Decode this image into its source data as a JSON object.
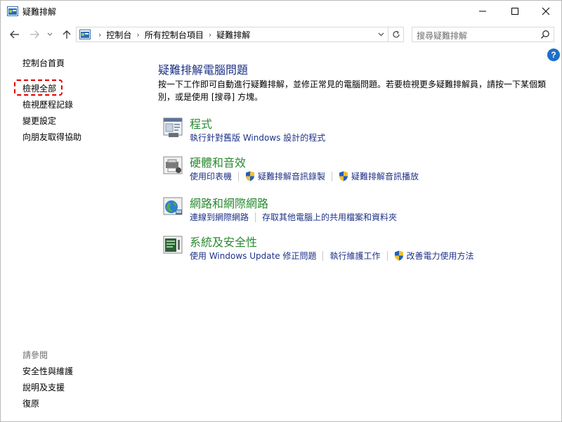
{
  "window": {
    "title": "疑難排解"
  },
  "nav": {
    "breadcrumbs": [
      "控制台",
      "所有控制台項目",
      "疑難排解"
    ],
    "search_placeholder": "搜尋疑難排解"
  },
  "left": {
    "home": "控制台首頁",
    "view_all": "檢視全部",
    "history": "檢視歷程記錄",
    "settings": "變更設定",
    "friend": "向朋友取得協助",
    "see_also": "請參閱",
    "security": "安全性與維護",
    "support": "說明及支援",
    "restore": "復原"
  },
  "main": {
    "title": "疑難排解電腦問題",
    "description": "按一下工作即可自動進行疑難排解，並修正常見的電腦問題。若要檢視更多疑難排解員，請按一下某個類別，或是使用 [搜尋] 方塊。",
    "categories": [
      {
        "title": "程式",
        "links": [
          "執行針對舊版 Windows 設計的程式"
        ]
      },
      {
        "title": "硬體和音效",
        "links": [
          "使用印表機",
          "疑難排解音訊錄製",
          "疑難排解音訊播放"
        ]
      },
      {
        "title": "網路和網際網路",
        "links": [
          "連線到網際網路",
          "存取其他電腦上的共用檔案和資料夾"
        ]
      },
      {
        "title": "系統及安全性",
        "links": [
          "使用 Windows Update 修正問題",
          "執行維護工作",
          "改善電力使用方法"
        ]
      }
    ]
  },
  "colors": {
    "link_blue": "#1e3287",
    "category_green": "#2a8a31",
    "highlight_red": "#e00000"
  }
}
